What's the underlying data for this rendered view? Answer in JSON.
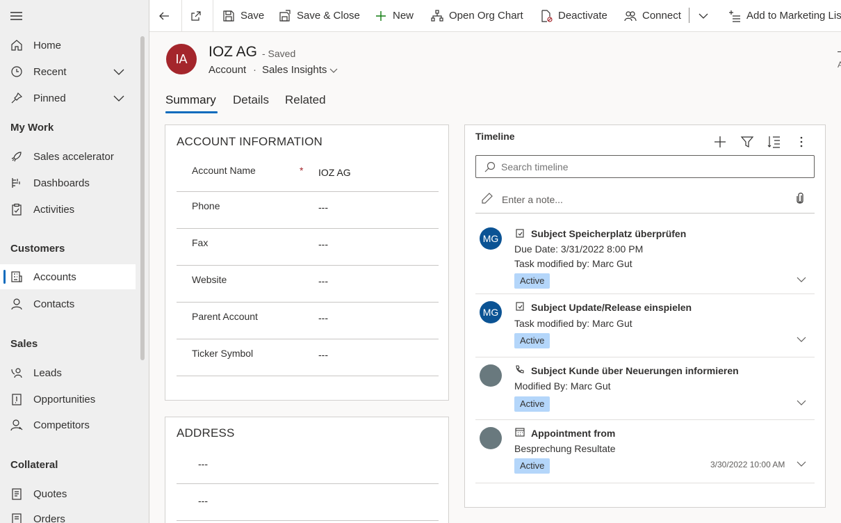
{
  "nav": {
    "items": [
      {
        "label": "Home",
        "icon": "home-icon"
      },
      {
        "label": "Recent",
        "icon": "clock-icon"
      },
      {
        "label": "Pinned",
        "icon": "pin-icon"
      }
    ],
    "my_work": {
      "header": "My Work",
      "items": [
        {
          "label": "Sales accelerator",
          "icon": "rocket-icon"
        },
        {
          "label": "Dashboards",
          "icon": "dashboard-icon"
        },
        {
          "label": "Activities",
          "icon": "clipboard-icon"
        }
      ]
    },
    "customers": {
      "header": "Customers",
      "items": [
        {
          "label": "Accounts",
          "icon": "building-icon"
        },
        {
          "label": "Contacts",
          "icon": "person-icon"
        }
      ]
    },
    "sales": {
      "header": "Sales",
      "items": [
        {
          "label": "Leads",
          "icon": "phone-person-icon"
        },
        {
          "label": "Opportunities",
          "icon": "clipboard-icon"
        },
        {
          "label": "Competitors",
          "icon": "person-icon"
        }
      ]
    },
    "collateral": {
      "header": "Collateral",
      "items": [
        {
          "label": "Quotes",
          "icon": "document-icon"
        },
        {
          "label": "Orders",
          "icon": "document-icon"
        }
      ]
    },
    "selected": "Accounts"
  },
  "commands": {
    "save": "Save",
    "save_close": "Save & Close",
    "new": "New",
    "org_chart": "Open Org Chart",
    "deactivate": "Deactivate",
    "connect": "Connect",
    "add_marketing": "Add to Marketing Lis"
  },
  "record": {
    "initials": "IA",
    "title": "IOZ AG",
    "saved_status": "- Saved",
    "entity": "Account",
    "separator": "·",
    "form_name": "Sales Insights",
    "edge_letter": "A"
  },
  "tabs": [
    "Summary",
    "Details",
    "Related"
  ],
  "account_info": {
    "title": "ACCOUNT INFORMATION",
    "fields": [
      {
        "label": "Account Name",
        "value": "IOZ AG",
        "required": true
      },
      {
        "label": "Phone",
        "value": "---"
      },
      {
        "label": "Fax",
        "value": "---"
      },
      {
        "label": "Website",
        "value": "---"
      },
      {
        "label": "Parent Account",
        "value": "---"
      },
      {
        "label": "Ticker Symbol",
        "value": "---"
      }
    ],
    "required_mark": "*"
  },
  "address": {
    "title": "ADDRESS",
    "values": [
      "---",
      "---"
    ]
  },
  "timeline": {
    "title": "Timeline",
    "search_placeholder": "Search timeline",
    "note_placeholder": "Enter a note...",
    "items": [
      {
        "avatar": "MG",
        "avatar_color": "#0b5394",
        "type_icon": "task-icon",
        "subject": "Subject Speicherplatz überprüfen",
        "lines": [
          "Due Date: 3/31/2022 8:00 PM",
          "Task modified by: Marc Gut"
        ],
        "status": "Active",
        "date": ""
      },
      {
        "avatar": "MG",
        "avatar_color": "#0b5394",
        "type_icon": "task-icon",
        "subject": "Subject Update/Release einspielen",
        "lines": [
          "Task modified by: Marc Gut"
        ],
        "status": "Active",
        "date": ""
      },
      {
        "avatar": "",
        "avatar_color": "#69797e",
        "type_icon": "phone-call-icon",
        "subject": "Subject Kunde über Neuerungen informieren",
        "lines": [
          "Modified By: Marc Gut"
        ],
        "status": "Active",
        "date": ""
      },
      {
        "avatar": "",
        "avatar_color": "#69797e",
        "type_icon": "calendar-icon",
        "subject": "Appointment from",
        "lines": [
          "Besprechung Resultate"
        ],
        "status": "Active",
        "date": "3/30/2022 10:00 AM"
      }
    ]
  },
  "colors": {
    "accent": "#0f6cbd",
    "record_avatar": "#a4262c",
    "status_badge": "#b4d6fa"
  }
}
